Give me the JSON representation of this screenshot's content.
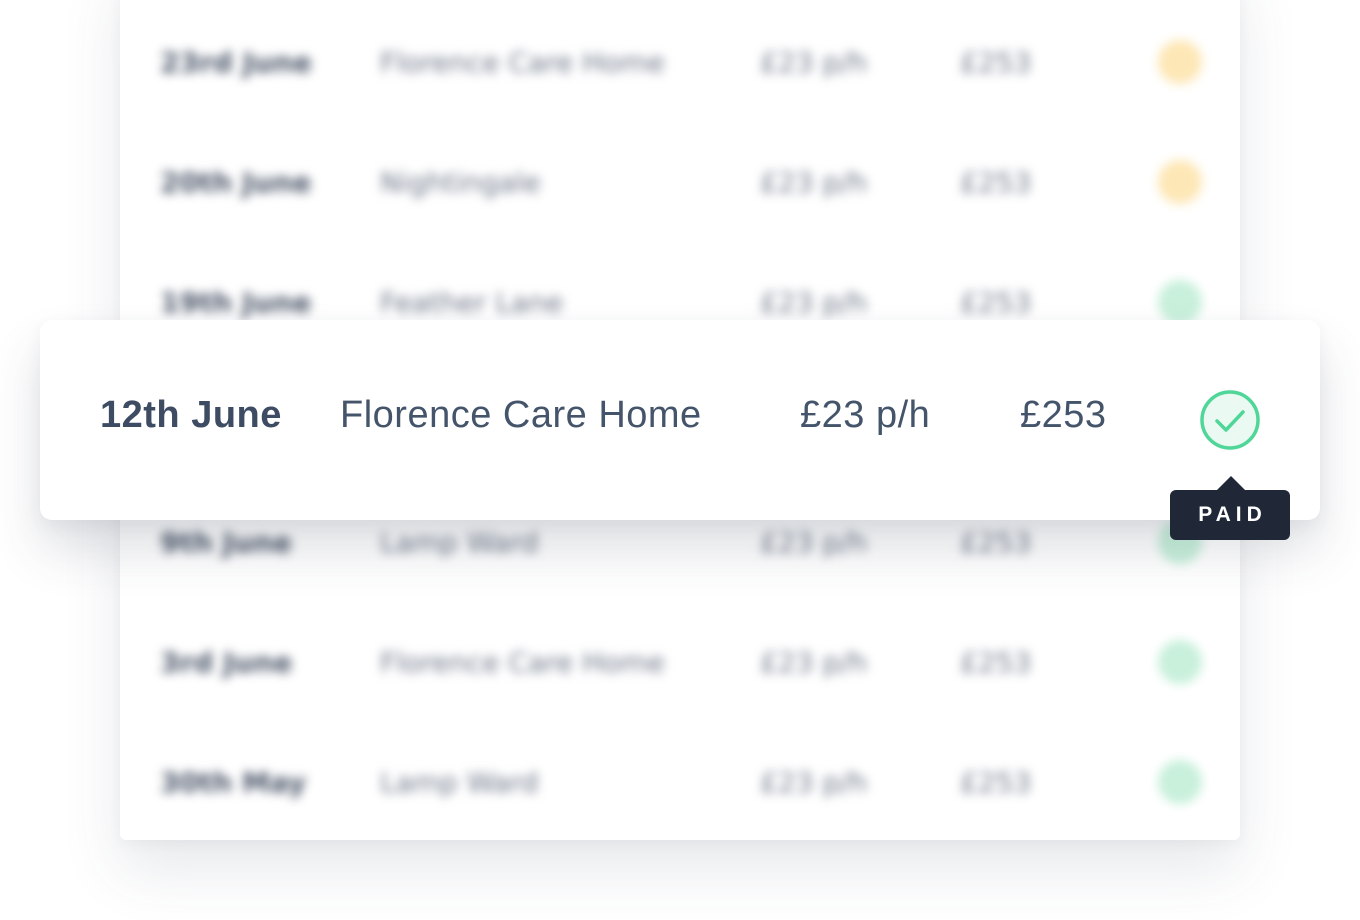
{
  "list": {
    "rows_before": [
      {
        "date": "23rd June",
        "place": "Florence Care Home",
        "rate": "£23 p/h",
        "total": "£253",
        "status": "pending"
      },
      {
        "date": "20th June",
        "place": "Nightingale",
        "rate": "£23 p/h",
        "total": "£253",
        "status": "pending"
      },
      {
        "date": "19th June",
        "place": "Feather Lane",
        "rate": "£23 p/h",
        "total": "£253",
        "status": "paid"
      }
    ],
    "rows_after": [
      {
        "date": "9th June",
        "place": "Lamp Ward",
        "rate": "£23 p/h",
        "total": "£253",
        "status": "paid"
      },
      {
        "date": "3rd June",
        "place": "Florence Care Home",
        "rate": "£23 p/h",
        "total": "£253",
        "status": "paid"
      },
      {
        "date": "30th May",
        "place": "Lamp Ward",
        "rate": "£23 p/h",
        "total": "£253",
        "status": "paid"
      }
    ]
  },
  "highlighted": {
    "date": "12th June",
    "place": "Florence Care Home",
    "rate": "£23 p/h",
    "total": "£253",
    "status": "paid",
    "status_icon": "check-circle-icon",
    "tooltip": "PAID"
  },
  "colors": {
    "paid": "#4fd698",
    "pending": "#fbd27a",
    "tooltip_bg": "#202838",
    "text": "#44546a"
  }
}
